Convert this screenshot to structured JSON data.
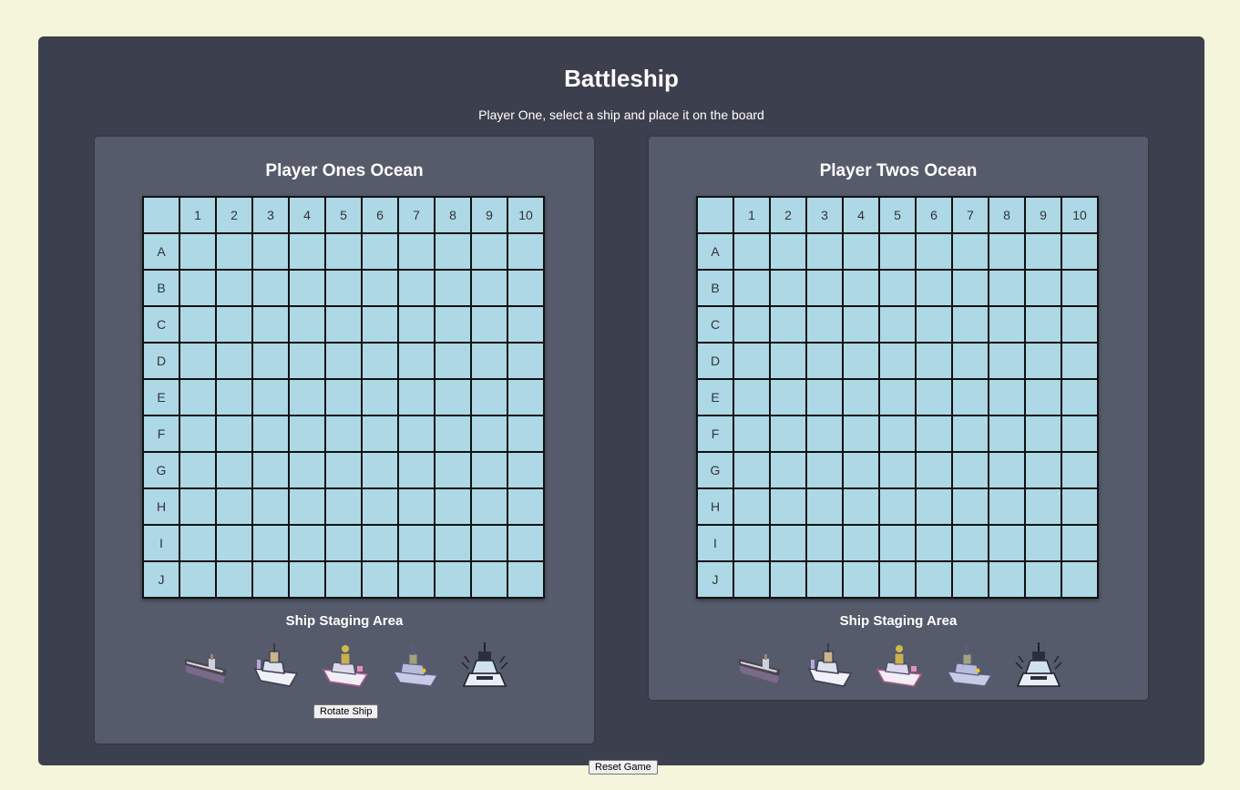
{
  "game": {
    "title": "Battleship",
    "status": "Player One, select a ship and place it on the board"
  },
  "columns": [
    "1",
    "2",
    "3",
    "4",
    "5",
    "6",
    "7",
    "8",
    "9",
    "10"
  ],
  "rows": [
    "A",
    "B",
    "C",
    "D",
    "E",
    "F",
    "G",
    "H",
    "I",
    "J"
  ],
  "boards": [
    {
      "title": "Player Ones Ocean",
      "staging_title": "Ship Staging Area",
      "ships": [
        "carrier-icon",
        "battleship-icon",
        "cruiser-icon",
        "submarine-icon",
        "destroyer-icon"
      ],
      "rotate_label": "Rotate Ship"
    },
    {
      "title": "Player Twos Ocean",
      "staging_title": "Ship Staging Area",
      "ships": [
        "carrier-icon",
        "battleship-icon",
        "cruiser-icon",
        "submarine-icon",
        "destroyer-icon"
      ]
    }
  ],
  "reset_label": "Reset Game",
  "colors": {
    "page_bg": "#f5f5dc",
    "app_bg": "#3c404d",
    "panel_bg": "#555b6a",
    "cell_bg": "#add8e6"
  }
}
